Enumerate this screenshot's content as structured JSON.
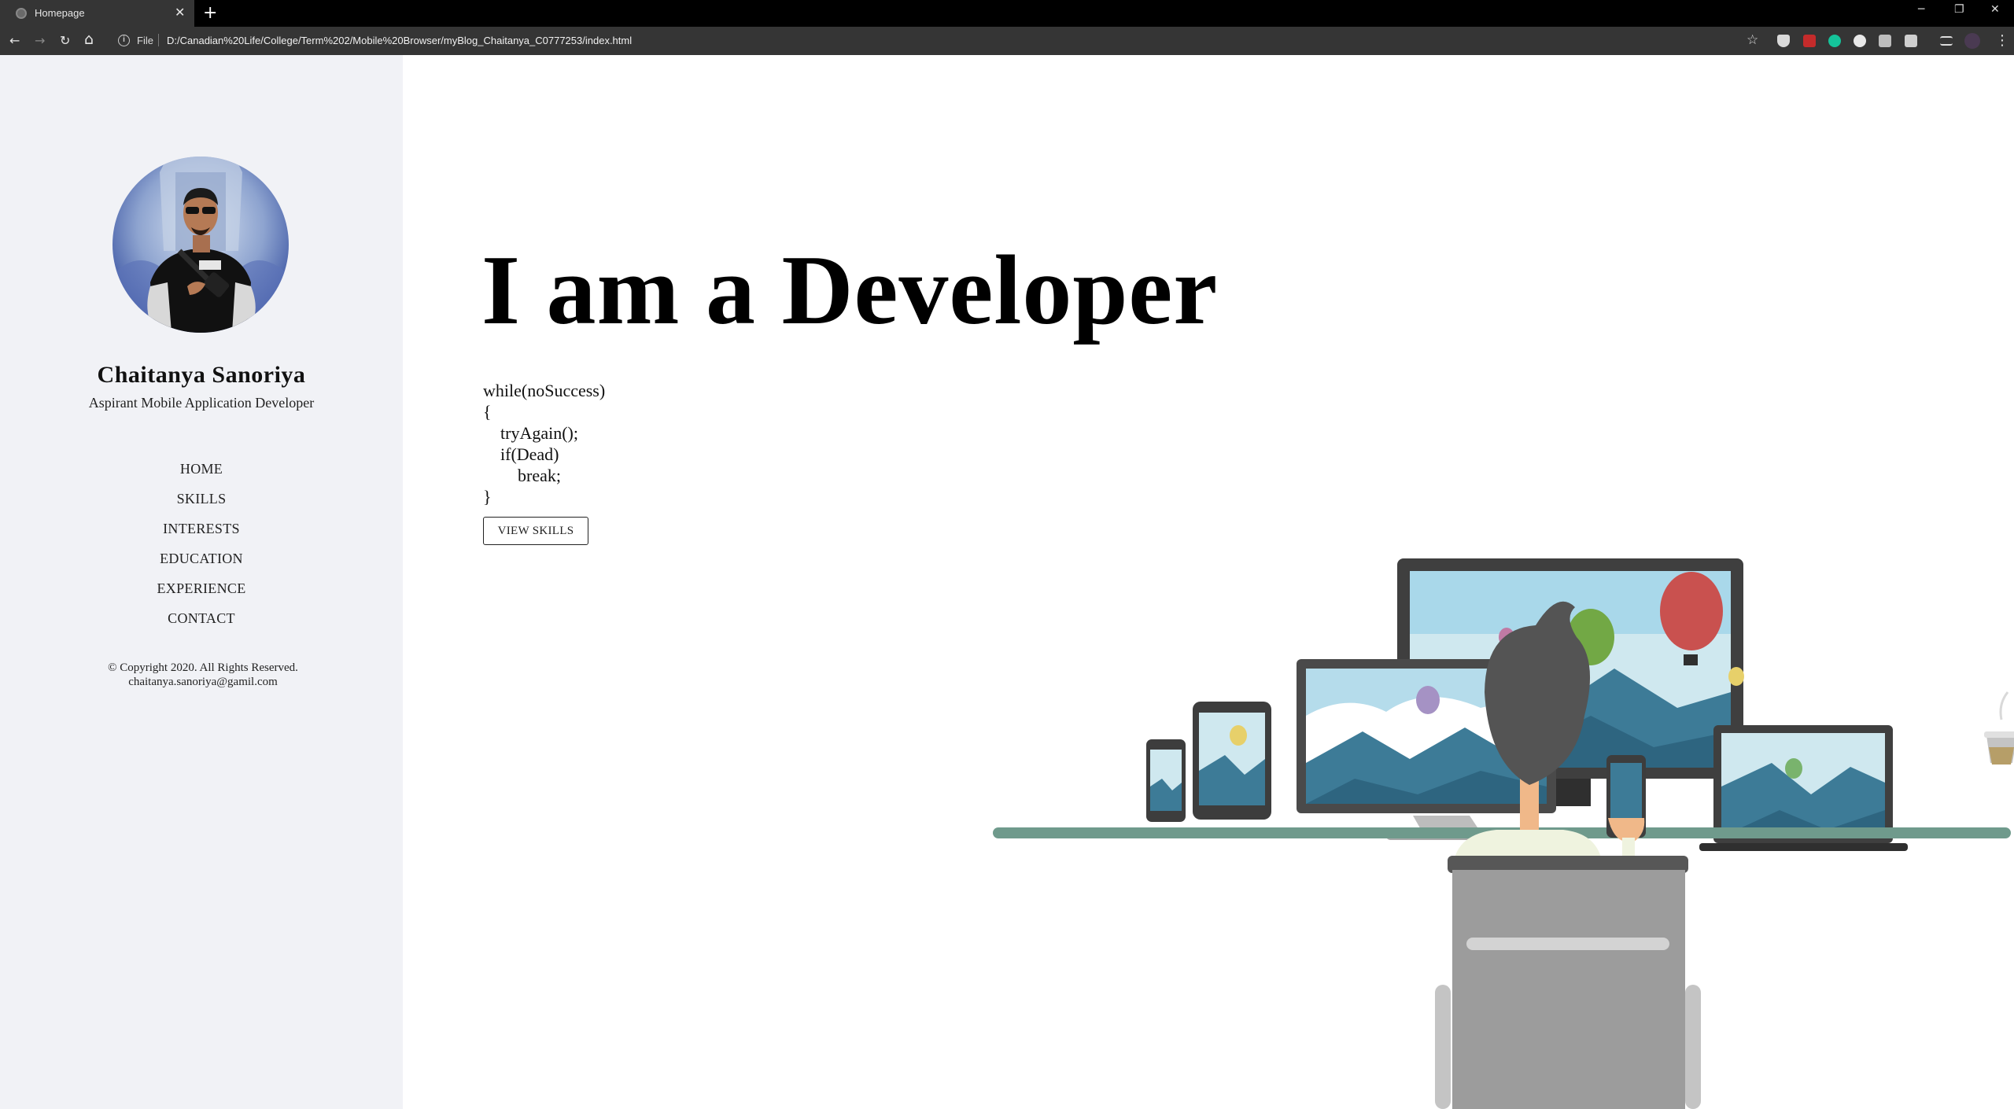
{
  "browser": {
    "tab_title": "Homepage",
    "tab_close": "✕",
    "new_tab": "+",
    "window_controls": {
      "minimize": "─",
      "restore": "❐",
      "close": "✕"
    },
    "nav": {
      "back": "←",
      "forward": "→",
      "reload": "↻",
      "home": "⌂"
    },
    "info_icon": "i",
    "scheme_label": "File",
    "url": "D:/Canadian%20Life/College/Term%202/Mobile%20Browser/myBlog_Chaitanya_C0777253/index.html",
    "star": "☆",
    "menu_dots": "⋮"
  },
  "sidebar": {
    "name": "Chaitanya Sanoriya",
    "role": "Aspirant Mobile Application Developer",
    "menu": [
      "HOME",
      "SKILLS",
      "INTERESTS",
      "EDUCATION",
      "EXPERIENCE",
      "CONTACT"
    ],
    "copyright": "© Copyright 2020. All Rights Reserved.",
    "email": "chaitanya.sanoriya@gamil.com"
  },
  "main": {
    "headline": "I am a Developer",
    "code_lines": [
      "while(noSuccess)",
      "{",
      "    tryAgain();",
      "    if(Dead)",
      "        break;",
      "}"
    ],
    "cta_label": "VIEW SKILLS"
  },
  "colors": {
    "sidebar_bg": "#f1f2f6",
    "chrome_bg": "#353535",
    "desk": "#6f9a8c",
    "hair": "#545454",
    "chair": "#9c9c9c",
    "balloon_red": "#c9514f",
    "balloon_green": "#72a845"
  }
}
